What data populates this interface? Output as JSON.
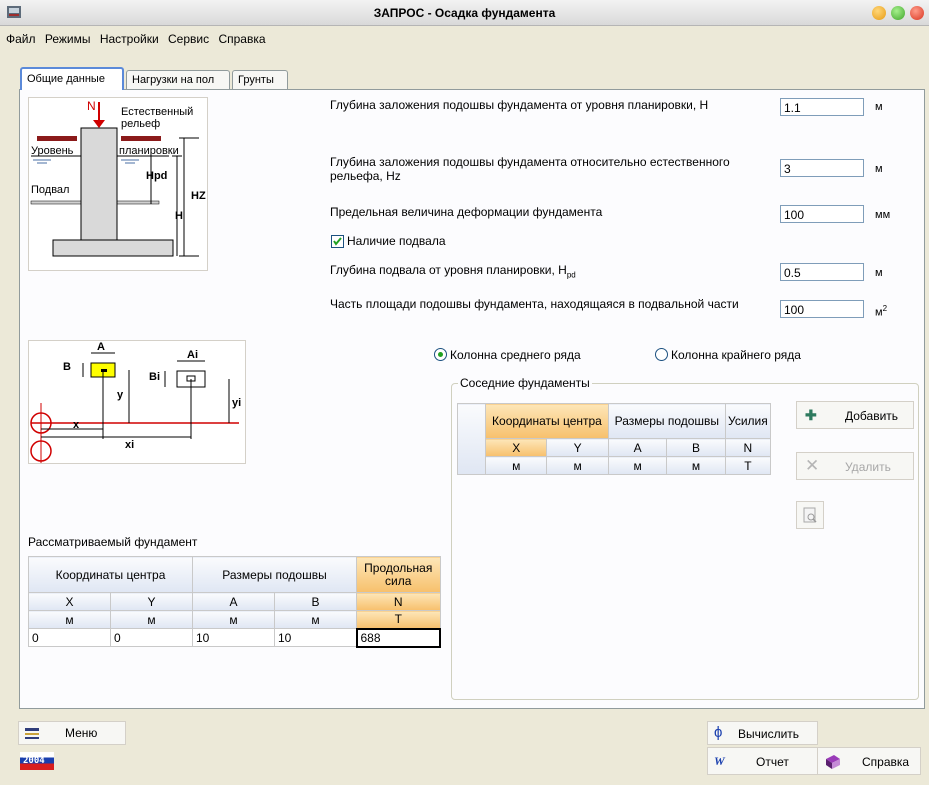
{
  "window": {
    "title": "ЗАПРОС - Осадка фундамента"
  },
  "menu": [
    "Файл",
    "Режимы",
    "Настройки",
    "Сервис",
    "Справка"
  ],
  "tabs": [
    {
      "label": "Общие данные",
      "active": true
    },
    {
      "label": "Нагрузки на пол",
      "active": false
    },
    {
      "label": "Грунты",
      "active": false
    }
  ],
  "fig1": {
    "n": "N",
    "natural_relief": "Естественный",
    "natural_relief2": "рельеф",
    "level": "Уровень",
    "planning": "планировки",
    "basement": "Подвал",
    "hpd": "Hpd",
    "hz": "HZ",
    "h": "H"
  },
  "fig2": {
    "a": "A",
    "b": "B",
    "ai": "Ai",
    "bi": "Bi",
    "y": "y",
    "yi": "yi",
    "x": "x",
    "xi": "xi"
  },
  "params": {
    "depth_label": "Глубина заложения подошвы фундамента от уровня планировки, H",
    "depth_value": "1.1",
    "depth_unit": "м",
    "depth_rel_label": "Глубина заложения подошвы фундамента относительно естественного рельефа, Hz",
    "depth_rel_value": "3",
    "depth_rel_unit": "м",
    "deform_label": "Предельная величина деформации фундамента",
    "deform_value": "100",
    "deform_unit": "мм",
    "basement_checkbox": "Наличие подвала",
    "basement_checked": true,
    "basement_depth_label": "Глубина подвала от уровня планировки, H",
    "basement_depth_sub": "pd",
    "basement_depth_value": "0.5",
    "basement_depth_unit": "м",
    "area_label": "Часть площади подошвы фундамента, находящаяся в подвальной части",
    "area_value": "100",
    "area_unit": "м",
    "area_unit_sup": "2"
  },
  "column_type": {
    "middle": "Колонна среднего ряда",
    "edge": "Колонна крайнего ряда",
    "selected": "middle"
  },
  "neighbors": {
    "group_title": "Соседние фундаменты",
    "headers": {
      "coords": "Координаты центра",
      "sizes": "Размеры подошвы",
      "force": "Усилия"
    },
    "cols": [
      "X",
      "Y",
      "A",
      "B",
      "N"
    ],
    "units": [
      "м",
      "м",
      "м",
      "м",
      "Т"
    ],
    "add_button": "Добавить",
    "delete_button": "Удалить"
  },
  "considered": {
    "title": "Рассматриваемый фундамент",
    "headers": {
      "coords": "Координаты центра",
      "sizes": "Размеры подошвы",
      "force": "Продольная сила"
    },
    "cols": [
      "X",
      "Y",
      "A",
      "B",
      "N"
    ],
    "units": [
      "м",
      "м",
      "м",
      "м",
      "Т"
    ],
    "row": [
      "0",
      "0",
      "10",
      "10",
      "688"
    ]
  },
  "bottom": {
    "menu_button": "Меню",
    "calc_button": "Вычислить",
    "report_button": "Отчет",
    "help_button": "Справка",
    "year_logo": "2004"
  }
}
